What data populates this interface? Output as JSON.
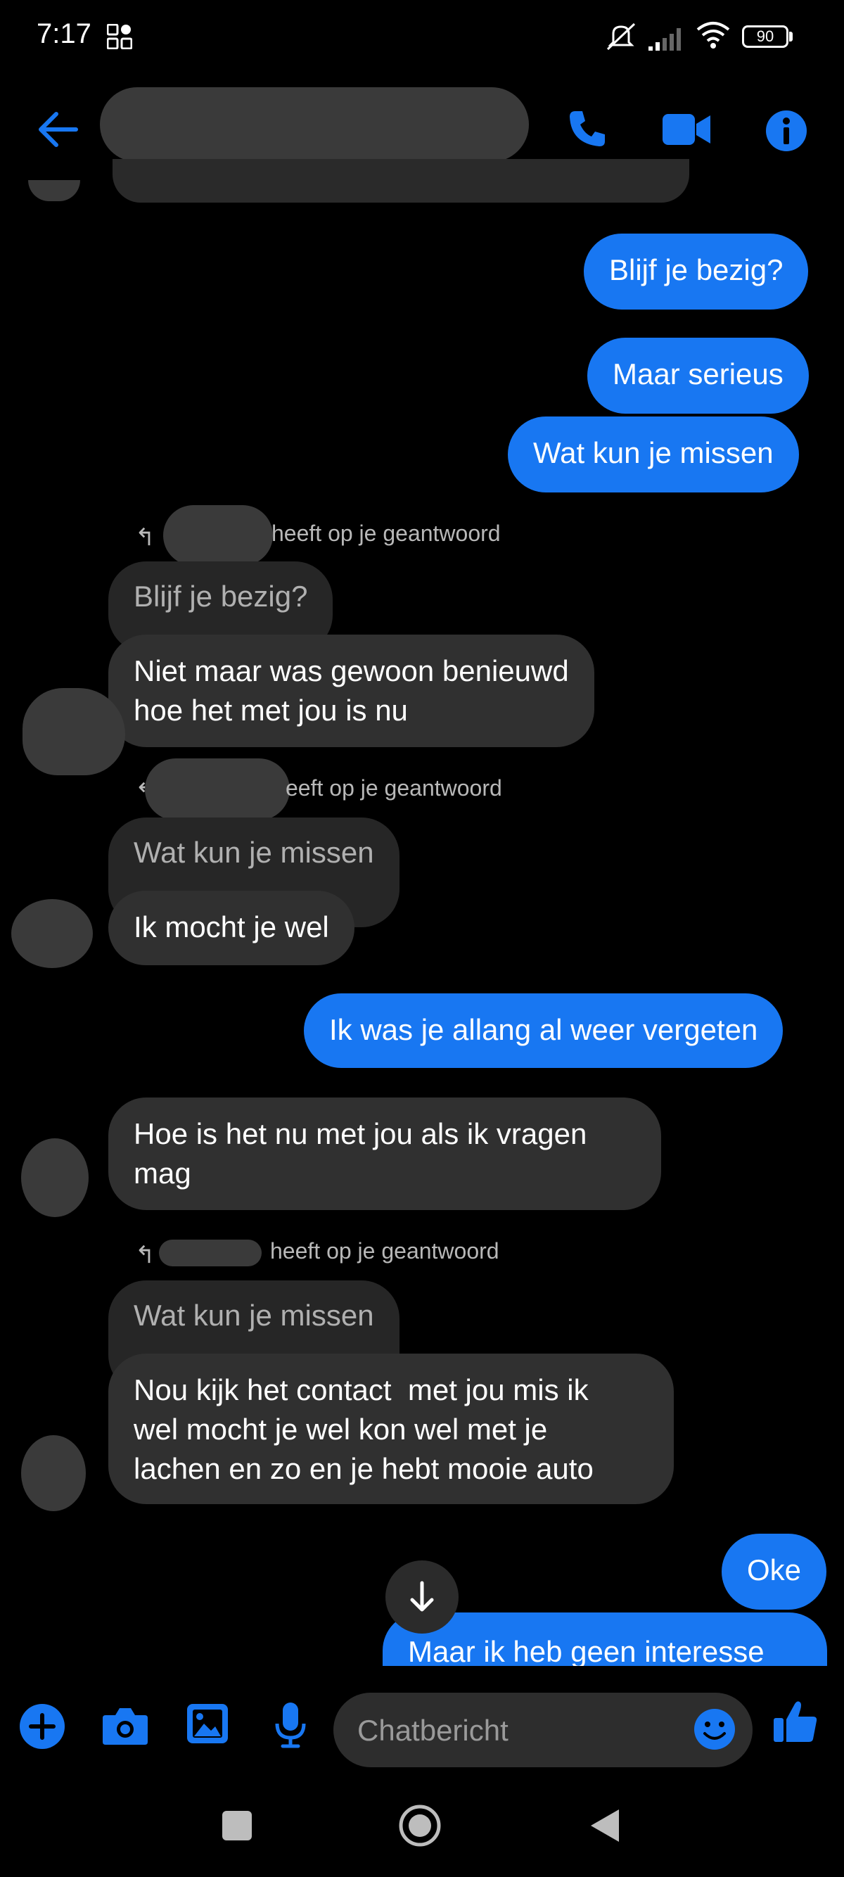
{
  "status_bar": {
    "time": "7:17",
    "battery": "90"
  },
  "header": {
    "back_icon": "arrow-left-icon",
    "call_icon": "phone-icon",
    "video_icon": "video-camera-icon",
    "info_icon": "info-icon"
  },
  "messages": {
    "m1": "Blijf je bezig?",
    "m2": "Maar serieus",
    "m3": "Wat kun je missen",
    "r1_meta": "heeft op je geantwoord",
    "r1_quote": "Blijf je bezig?",
    "r1_text": "Niet maar was gewoon benieuwd\nhoe het met jou is nu",
    "r2_meta": "eeft op je geantwoord",
    "r2_quote": "Wat kun je missen",
    "r2_text": "Ik mocht je wel",
    "m4": "Ik was je allang al weer vergeten",
    "m5": "Hoe is het nu met jou als ik vragen\nmag",
    "r3_meta": "heeft op je geantwoord",
    "r3_quote": "Wat kun je missen",
    "r3_text": "Nou kijk het contact  met jou mis ik\nwel mocht je wel kon wel met je\nlachen en zo en je hebt mooie auto",
    "m6": "Oke",
    "m7": "Maar ik heb geen interesse"
  },
  "composer": {
    "placeholder": "Chatbericht",
    "icons": [
      "plus-icon",
      "camera-icon",
      "image-icon",
      "microphone-icon",
      "emoji-icon",
      "thumbs-up-icon"
    ]
  },
  "colors": {
    "accent": "#1877f2",
    "incoming": "#303030",
    "quote": "#262626",
    "background": "#000000"
  }
}
